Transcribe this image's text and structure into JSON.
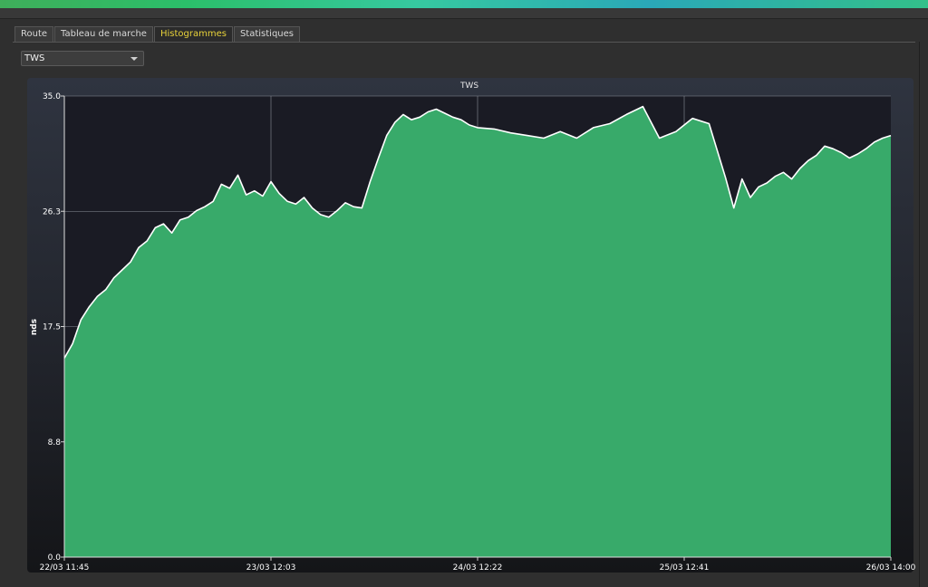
{
  "tabs": [
    {
      "label": "Route",
      "active": false
    },
    {
      "label": "Tableau de marche",
      "active": false
    },
    {
      "label": "Histogrammes",
      "active": true
    },
    {
      "label": "Statistiques",
      "active": false
    }
  ],
  "variable_select": {
    "value": "TWS"
  },
  "colors": {
    "fill": "#38aa6a",
    "line": "#ffffff",
    "active_tab": "#e8d23a"
  },
  "chart_data": {
    "type": "area",
    "title": "TWS",
    "xlabel": "",
    "ylabel": "nds",
    "ylim": [
      0,
      35
    ],
    "yticks": [
      "0.0",
      "8.8",
      "17.5",
      "26.3",
      "35.0"
    ],
    "xticks": [
      "22/03 11:45",
      "23/03 12:03",
      "24/03 12:22",
      "25/03 12:41",
      "26/03 14:00"
    ],
    "grid": true,
    "series": [
      {
        "x": [
          0,
          0.01,
          0.02,
          0.03,
          0.04,
          0.05,
          0.06,
          0.07,
          0.08,
          0.09,
          0.1,
          0.11,
          0.12,
          0.13,
          0.14,
          0.15,
          0.16,
          0.17,
          0.18,
          0.19,
          0.2,
          0.21,
          0.22,
          0.23,
          0.24,
          0.25,
          0.26,
          0.27,
          0.28,
          0.29,
          0.3,
          0.31,
          0.32,
          0.33,
          0.34,
          0.35,
          0.36,
          0.37,
          0.38,
          0.39,
          0.4,
          0.41,
          0.42,
          0.43,
          0.44,
          0.45,
          0.46,
          0.47,
          0.48,
          0.49,
          0.5,
          0.52,
          0.54,
          0.56,
          0.58,
          0.6,
          0.62,
          0.64,
          0.66,
          0.68,
          0.7,
          0.72,
          0.74,
          0.76,
          0.78,
          0.8,
          0.81,
          0.82,
          0.83,
          0.84,
          0.85,
          0.86,
          0.87,
          0.88,
          0.89,
          0.9,
          0.91,
          0.92,
          0.93,
          0.94,
          0.95,
          0.96,
          0.97,
          0.98,
          0.99,
          1.0
        ],
        "values": [
          15.1,
          16.2,
          18.0,
          19.0,
          19.8,
          20.3,
          21.2,
          21.8,
          22.4,
          23.5,
          24.0,
          25.0,
          25.3,
          24.6,
          25.6,
          25.8,
          26.3,
          26.6,
          27.0,
          28.3,
          28.0,
          29.0,
          27.5,
          27.8,
          27.4,
          28.5,
          27.6,
          27.0,
          26.8,
          27.3,
          26.5,
          26.0,
          25.8,
          26.3,
          26.9,
          26.6,
          26.5,
          28.5,
          30.3,
          32.0,
          33.0,
          33.6,
          33.2,
          33.4,
          33.8,
          34.0,
          33.7,
          33.4,
          33.2,
          32.8,
          32.6,
          32.5,
          32.2,
          32.0,
          31.8,
          32.3,
          31.8,
          32.6,
          32.9,
          33.6,
          34.2,
          31.8,
          32.3,
          33.3,
          32.9,
          28.8,
          26.5,
          28.7,
          27.3,
          28.1,
          28.4,
          28.9,
          29.2,
          28.7,
          29.5,
          30.1,
          30.5,
          31.2,
          31.0,
          30.7,
          30.3,
          30.6,
          31.0,
          31.5,
          31.8,
          32.0
        ]
      }
    ]
  }
}
